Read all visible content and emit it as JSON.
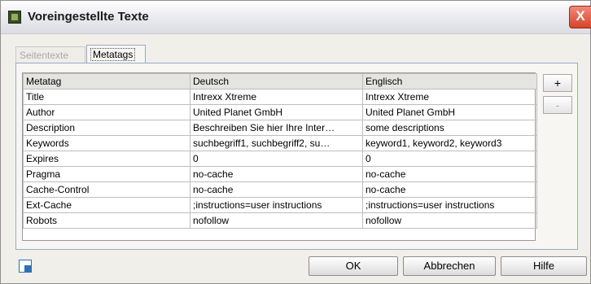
{
  "window": {
    "title": "Voreingestellte Texte",
    "close_glyph": "X"
  },
  "tabs": [
    {
      "label": "Seitentexte",
      "active": false
    },
    {
      "label": "Metatags",
      "active": true
    }
  ],
  "table": {
    "headers": [
      "Metatag",
      "Deutsch",
      "Englisch"
    ],
    "rows": [
      [
        "Title",
        "Intrexx Xtreme",
        "Intrexx Xtreme"
      ],
      [
        "Author",
        "United Planet GmbH",
        "United Planet GmbH"
      ],
      [
        "Description",
        "Beschreiben Sie hier Ihre Inter…",
        "some descriptions"
      ],
      [
        "Keywords",
        "suchbegriff1, suchbegriff2, su…",
        "keyword1, keyword2, keyword3"
      ],
      [
        "Expires",
        "0",
        "0"
      ],
      [
        "Pragma",
        "no-cache",
        "no-cache"
      ],
      [
        "Cache-Control",
        "no-cache",
        "no-cache"
      ],
      [
        "Ext-Cache",
        ";instructions=user instructions",
        ";instructions=user instructions"
      ],
      [
        "Robots",
        "nofollow",
        "nofollow"
      ]
    ]
  },
  "side_buttons": {
    "add": "+",
    "remove": "-"
  },
  "footer": {
    "ok": "OK",
    "cancel": "Abbrechen",
    "help": "Hilfe"
  }
}
